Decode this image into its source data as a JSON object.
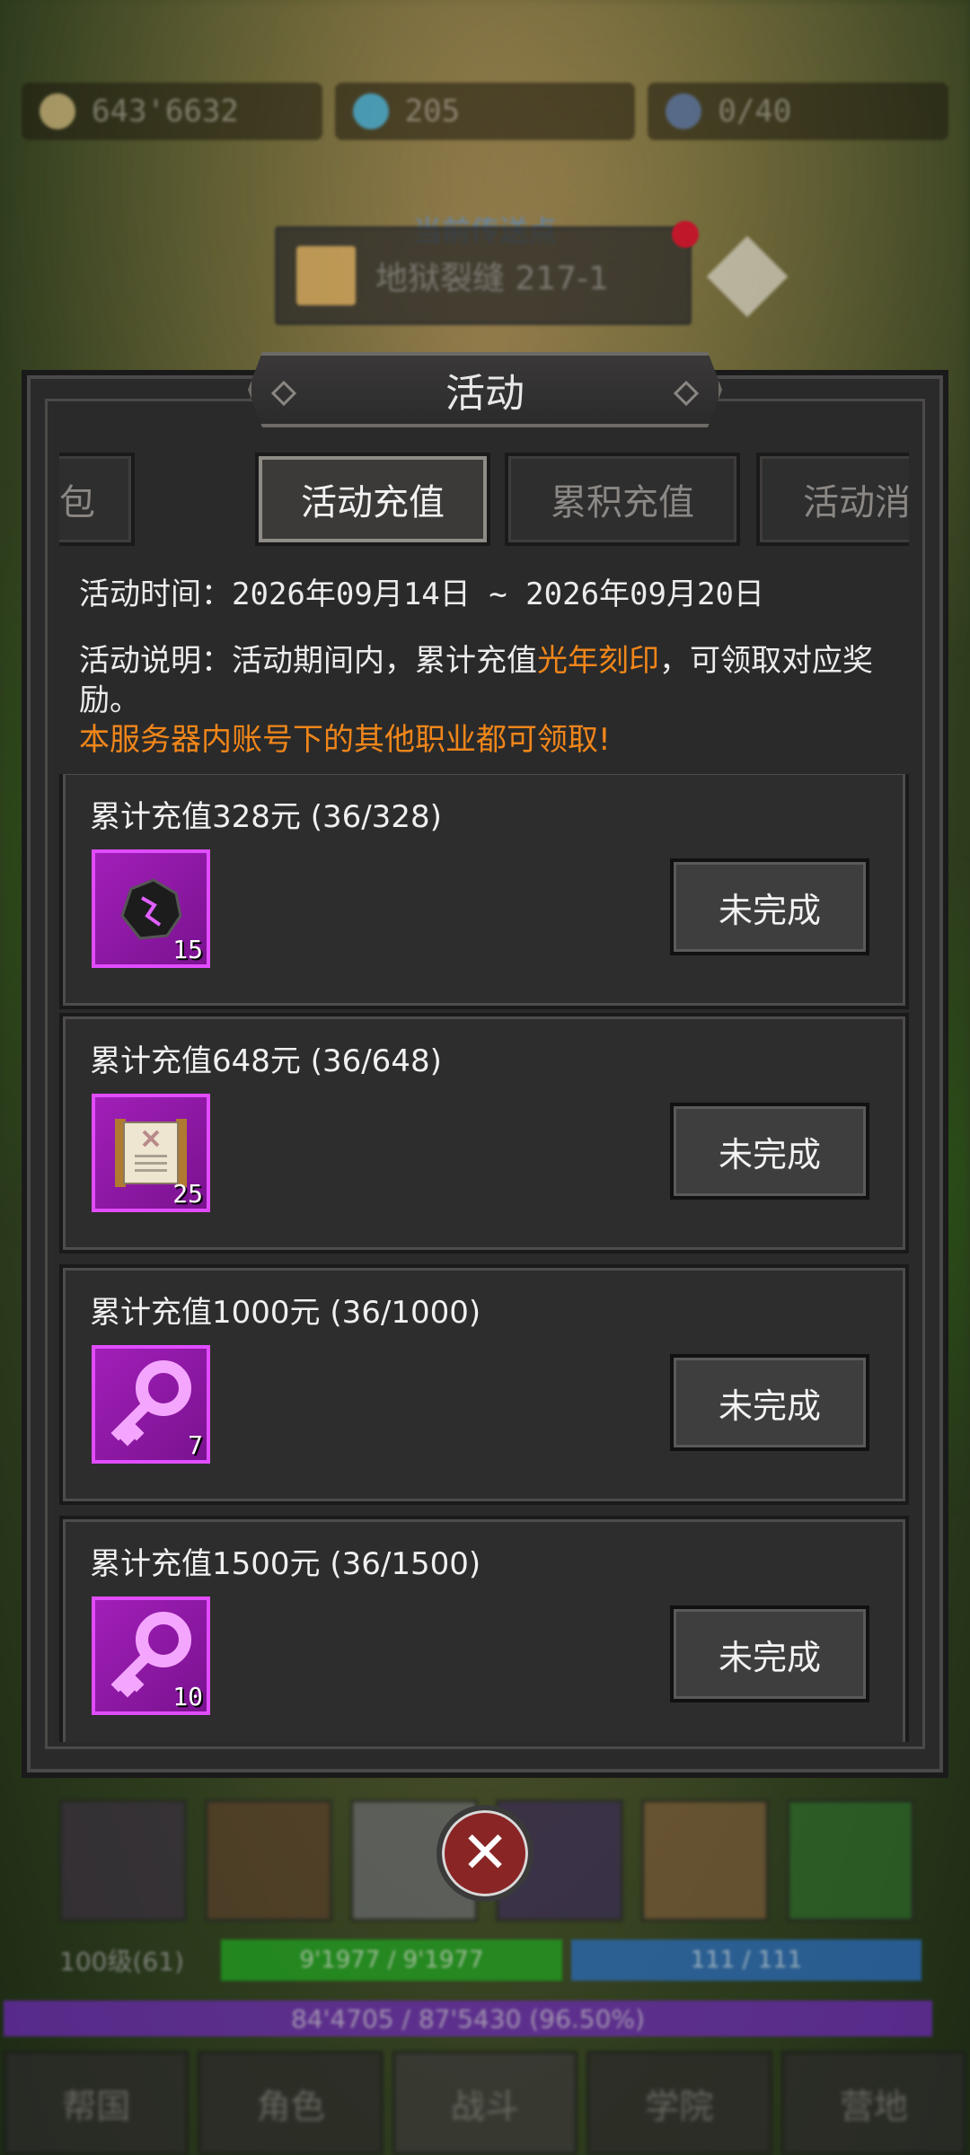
{
  "currencies": [
    {
      "name": "gold",
      "icon": "coin-icon",
      "value": "643'6632"
    },
    {
      "name": "gem",
      "icon": "diamond-icon",
      "value": "205"
    },
    {
      "name": "crystal",
      "icon": "crystal-icon",
      "value": "0/40"
    }
  ],
  "teleport": {
    "title": "当前传送点",
    "location": "地狱裂缝 217-1"
  },
  "panel": {
    "title": "活动"
  },
  "tabs": [
    {
      "label": "限时礼包",
      "active": false
    },
    {
      "label": "活动充值",
      "active": true
    },
    {
      "label": "累积充值",
      "active": false
    },
    {
      "label": "活动消",
      "active": false
    }
  ],
  "activity": {
    "time_label": "活动时间：",
    "time_value": "2026年09月14日 ~ 2026年09月20日",
    "desc_label": "活动说明：活动期间内，累计充值",
    "desc_highlight": "光年刻印",
    "desc_rest": "，可领取对应奖励。",
    "desc_note": "本服务器内账号下的其他职业都可领取!"
  },
  "rewards": [
    {
      "title": "累计充值328元 (36/328)",
      "item_icon": "dark-stone-icon",
      "count": "15",
      "button": "未完成"
    },
    {
      "title": "累计充值648元 (36/648)",
      "item_icon": "scroll-icon",
      "count": "25",
      "button": "未完成"
    },
    {
      "title": "累计充值1000元 (36/1000)",
      "item_icon": "pink-key-icon",
      "count": "7",
      "button": "未完成"
    },
    {
      "title": "累计充值1500元 (36/1500)",
      "item_icon": "pink-key-icon",
      "count": "10",
      "button": "未完成"
    }
  ],
  "hud": {
    "level": "100级(61)",
    "hp": "9'1977 / 9'1977",
    "mp": "111 / 111",
    "exp": "84'4705 / 87'5430 (96.50%)"
  },
  "nav": [
    "帮国",
    "角色",
    "战斗",
    "学院",
    "营地"
  ],
  "colors": {
    "highlight": "#f0861a",
    "item_rarity": "#e04cff",
    "close_button": "#8a2525"
  }
}
